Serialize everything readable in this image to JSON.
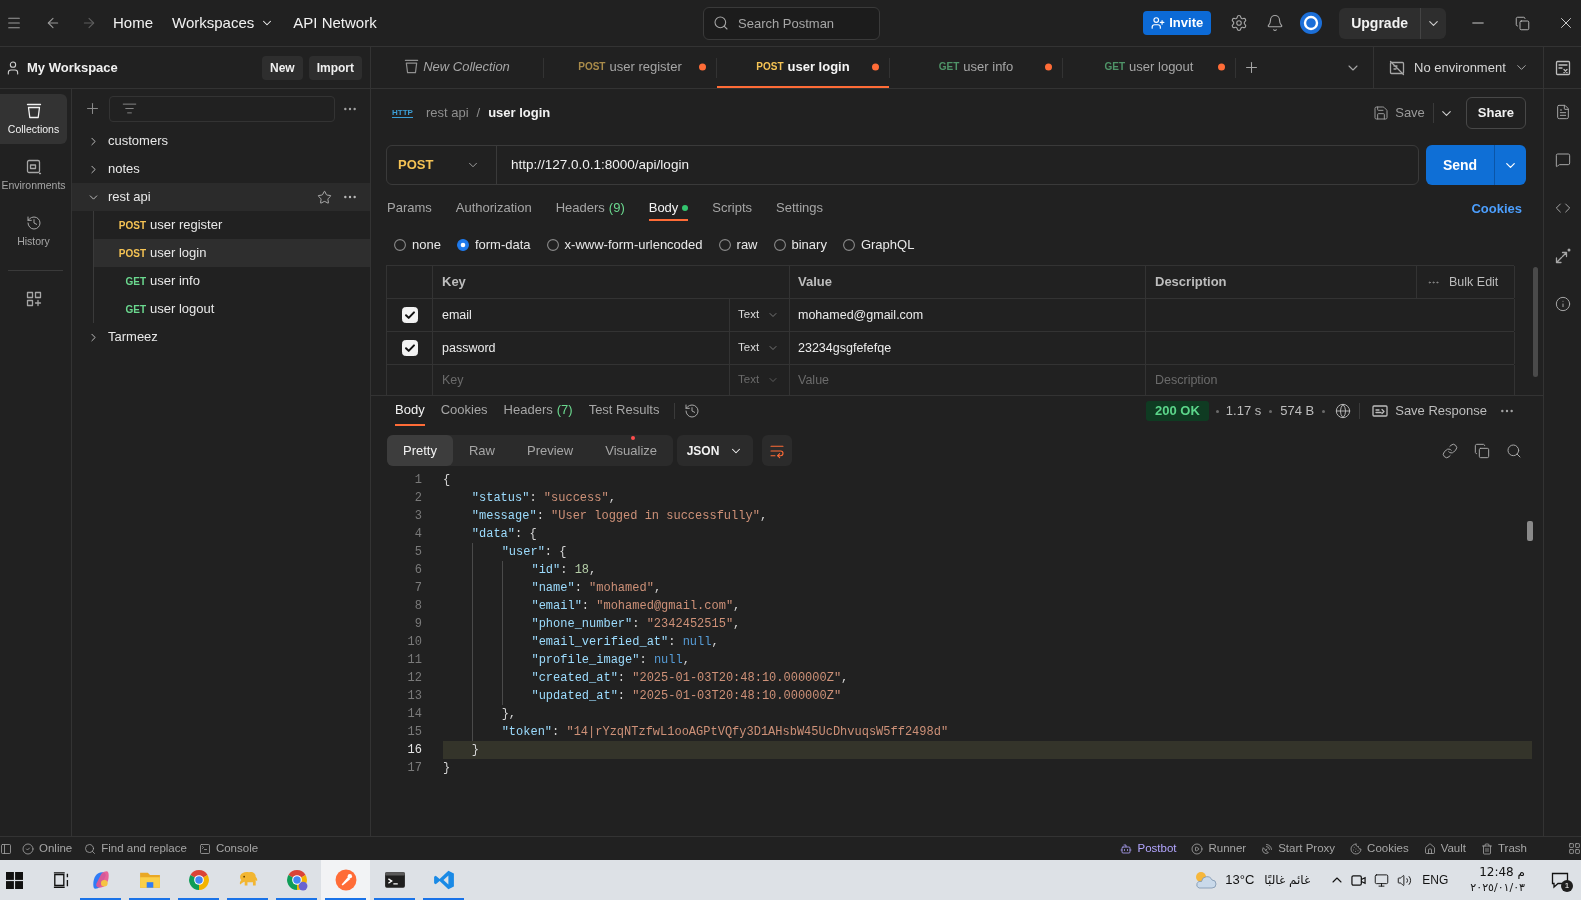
{
  "title_bar": {
    "nav": [
      {
        "kind": "link",
        "label": "Home"
      },
      {
        "kind": "dropdown",
        "label": "Workspaces"
      },
      {
        "kind": "link",
        "label": "API Network"
      }
    ],
    "search": {
      "placeholder": "Search Postman"
    },
    "invite": "Invite",
    "upgrade": "Upgrade"
  },
  "workspace": {
    "name": "My Workspace",
    "new": "New",
    "import": "Import"
  },
  "tabs": [
    {
      "kind": "collection",
      "label": "New Collection",
      "selected": false,
      "unsaved": false
    },
    {
      "kind": "post",
      "method": "POST",
      "label": "user register",
      "selected": false,
      "unsaved": true
    },
    {
      "kind": "post",
      "method": "POST",
      "label": "user login",
      "selected": true,
      "unsaved": true
    },
    {
      "kind": "get",
      "method": "GET",
      "label": "user info",
      "selected": false,
      "unsaved": true
    },
    {
      "kind": "get",
      "method": "GET",
      "label": "user logout",
      "selected": false,
      "unsaved": true
    }
  ],
  "environment": "No environment",
  "rail": [
    {
      "kind": "collections",
      "label": "Collections",
      "selected": true
    },
    {
      "kind": "environments",
      "label": "Environments",
      "selected": false
    },
    {
      "kind": "history",
      "label": "History",
      "selected": false
    }
  ],
  "tree": [
    {
      "name": "customers",
      "expanded": false,
      "hovered": false
    },
    {
      "name": "notes",
      "expanded": false,
      "hovered": false
    },
    {
      "name": "rest api",
      "expanded": true,
      "hovered": true,
      "children": [
        {
          "kind": "post",
          "method": "POST",
          "name": "user register",
          "selected": false
        },
        {
          "kind": "post",
          "method": "POST",
          "name": "user login",
          "selected": true
        },
        {
          "kind": "get",
          "method": "GET",
          "name": "user info",
          "selected": false
        },
        {
          "kind": "get",
          "method": "GET",
          "name": "user logout",
          "selected": false
        }
      ]
    },
    {
      "name": "Tarmeez",
      "expanded": false,
      "hovered": false
    }
  ],
  "breadcrumb": {
    "badge": "HTTP",
    "parent": "rest api",
    "separator": "/",
    "current": "user login"
  },
  "actions": {
    "save": "Save",
    "share": "Share"
  },
  "request": {
    "kind": "post",
    "method": "POST",
    "url": "http://127.0.0.1:8000/api/login",
    "send": "Send"
  },
  "request_tabs": [
    {
      "label": "Params",
      "selected": false,
      "has_content": false
    },
    {
      "label": "Authorization",
      "selected": false,
      "has_content": false
    },
    {
      "label": "Headers",
      "count": "(9)",
      "selected": false,
      "has_content": false
    },
    {
      "label": "Body",
      "selected": true,
      "has_content": true
    },
    {
      "label": "Scripts",
      "selected": false,
      "has_content": false
    },
    {
      "label": "Settings",
      "selected": false,
      "has_content": false
    }
  ],
  "cookies": "Cookies",
  "body_types": [
    {
      "label": "none",
      "selected": false
    },
    {
      "label": "form-data",
      "selected": true
    },
    {
      "label": "x-www-form-urlencoded",
      "selected": false
    },
    {
      "label": "raw",
      "selected": false
    },
    {
      "label": "binary",
      "selected": false
    },
    {
      "label": "GraphQL",
      "selected": false
    }
  ],
  "form_table": {
    "columns": [
      "Key",
      "Value",
      "Description"
    ],
    "bulk_edit": "Bulk Edit",
    "rows": [
      {
        "checked": true,
        "key": "email",
        "type": "Text",
        "value": "mohamed@gmail.com"
      },
      {
        "checked": true,
        "key": "password",
        "type": "Text",
        "value": "23234gsgfefefqe"
      }
    ],
    "new_row": {
      "key": {
        "placeholder": "Key"
      },
      "type": "Text",
      "value": {
        "placeholder": "Value"
      },
      "description": {
        "placeholder": "Description"
      }
    }
  },
  "response": {
    "tabs": [
      {
        "label": "Body",
        "selected": true
      },
      {
        "label": "Cookies",
        "selected": false
      },
      {
        "label": "Headers",
        "count": "(7)",
        "selected": false
      },
      {
        "label": "Test Results",
        "selected": false
      }
    ],
    "status": "200 OK",
    "time": "1.17 s",
    "size": "574 B",
    "save_response": "Save Response",
    "views": [
      {
        "label": "Pretty",
        "selected": true,
        "notice": false
      },
      {
        "label": "Raw",
        "selected": false,
        "notice": false
      },
      {
        "label": "Preview",
        "selected": false,
        "notice": false
      },
      {
        "label": "Visualize",
        "selected": false,
        "notice": true
      }
    ],
    "format": "JSON",
    "lines": [
      {
        "number": "1",
        "text": "{",
        "selected": false
      },
      {
        "number": "2",
        "text": "    \"status\": \"success\",",
        "selected": false
      },
      {
        "number": "3",
        "text": "    \"message\": \"User logged in successfully\",",
        "selected": false
      },
      {
        "number": "4",
        "text": "    \"data\": {",
        "selected": false
      },
      {
        "number": "5",
        "text": "        \"user\": {",
        "selected": false
      },
      {
        "number": "6",
        "text": "            \"id\": 18,",
        "selected": false
      },
      {
        "number": "7",
        "text": "            \"name\": \"mohamed\",",
        "selected": false
      },
      {
        "number": "8",
        "text": "            \"email\": \"mohamed@gmail.com\",",
        "selected": false
      },
      {
        "number": "9",
        "text": "            \"phone_number\": \"2342452515\",",
        "selected": false
      },
      {
        "number": "10",
        "text": "            \"email_verified_at\": null,",
        "selected": false
      },
      {
        "number": "11",
        "text": "            \"profile_image\": null,",
        "selected": false
      },
      {
        "number": "12",
        "text": "            \"created_at\": \"2025-01-03T20:48:10.000000Z\",",
        "selected": false
      },
      {
        "number": "13",
        "text": "            \"updated_at\": \"2025-01-03T20:48:10.000000Z\"",
        "selected": false
      },
      {
        "number": "14",
        "text": "        },",
        "selected": false
      },
      {
        "number": "15",
        "text": "        \"token\": \"14|rYzqNTzfwL1ooAGPtVQfy3D1AHsbW45UcDhvuqsW5ff2498d\"",
        "selected": false
      },
      {
        "number": "16",
        "text": "    }",
        "selected": true
      },
      {
        "number": "17",
        "text": "}",
        "selected": false
      }
    ]
  },
  "status_bar": {
    "left": [
      {
        "kind": "online",
        "label": "Online"
      },
      {
        "kind": "find",
        "label": "Find and replace"
      },
      {
        "kind": "console",
        "label": "Console"
      }
    ],
    "right": [
      {
        "kind": "postbot",
        "label": "Postbot"
      },
      {
        "kind": "runner",
        "label": "Runner"
      },
      {
        "kind": "proxy",
        "label": "Start Proxy"
      },
      {
        "kind": "cookies",
        "label": "Cookies"
      },
      {
        "kind": "vault",
        "label": "Vault"
      },
      {
        "kind": "trash",
        "label": "Trash"
      }
    ]
  },
  "taskbar": {
    "apps": [
      {
        "kind": "swirl",
        "running": true,
        "selected": false
      },
      {
        "kind": "folder",
        "running": true,
        "selected": false
      },
      {
        "kind": "browser",
        "running": true,
        "selected": false
      },
      {
        "kind": "elephant",
        "running": true,
        "selected": false
      },
      {
        "kind": "browser_profile",
        "running": true,
        "selected": false
      },
      {
        "kind": "circle_logo",
        "running": true,
        "selected": true
      },
      {
        "kind": "terminal",
        "running": true,
        "selected": false
      },
      {
        "kind": "code_editor",
        "running": true,
        "selected": false
      }
    ],
    "weather": {
      "temperature": "13°C",
      "condition": "غائم غالبًا"
    },
    "language": "ENG",
    "time": "12:48 م",
    "date": "٢٠٢٥/٠١/٠٣",
    "notifications": "1"
  }
}
